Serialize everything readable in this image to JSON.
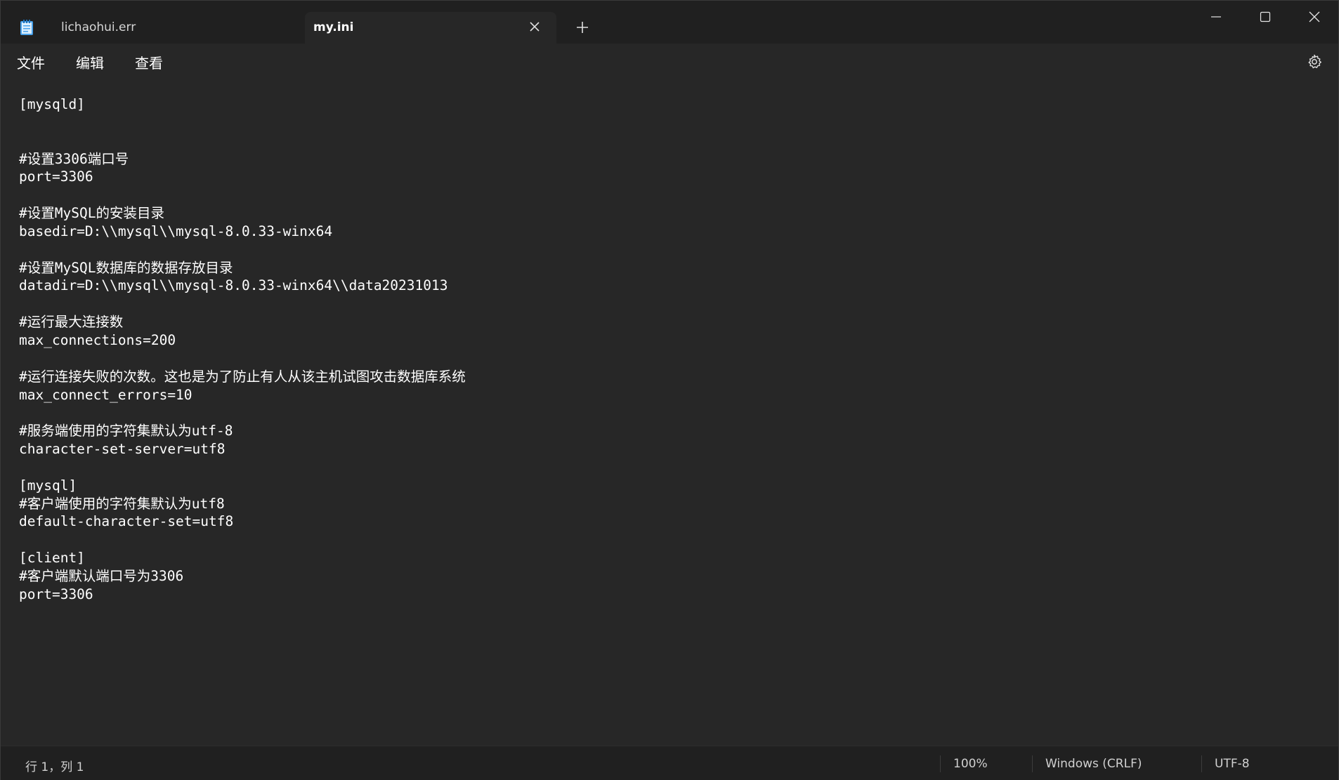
{
  "tabs": [
    {
      "label": "lichaohui.err",
      "active": false
    },
    {
      "label": "my.ini",
      "active": true
    }
  ],
  "icons": {
    "app": "notepad-icon",
    "tab_close": "close-icon",
    "new_tab": "plus-icon",
    "minimize": "minimize-icon",
    "maximize": "maximize-icon",
    "close": "close-icon",
    "settings": "gear-icon"
  },
  "menu": {
    "file": "文件",
    "edit": "编辑",
    "view": "查看"
  },
  "editor": {
    "content": "[mysqld]\n\n\n#设置3306端口号\nport=3306\n\n#设置MySQL的安装目录\nbasedir=D:\\\\mysql\\\\mysql-8.0.33-winx64\n\n#设置MySQL数据库的数据存放目录\ndatadir=D:\\\\mysql\\\\mysql-8.0.33-winx64\\\\data20231013\n\n#运行最大连接数\nmax_connections=200\n\n#运行连接失败的次数。这也是为了防止有人从该主机试图攻击数据库系统\nmax_connect_errors=10\n\n#服务端使用的字符集默认为utf-8\ncharacter-set-server=utf8\n\n[mysql]\n#客户端使用的字符集默认为utf8\ndefault-character-set=utf8\n\n[client]\n#客户端默认端口号为3306\nport=3306"
  },
  "status": {
    "position": "行 1，列 1",
    "zoom": "100%",
    "line_ending": "Windows (CRLF)",
    "encoding": "UTF-8"
  },
  "colors": {
    "titlebar": "#202020",
    "editor_bg": "#272727",
    "text": "#ffffff"
  }
}
